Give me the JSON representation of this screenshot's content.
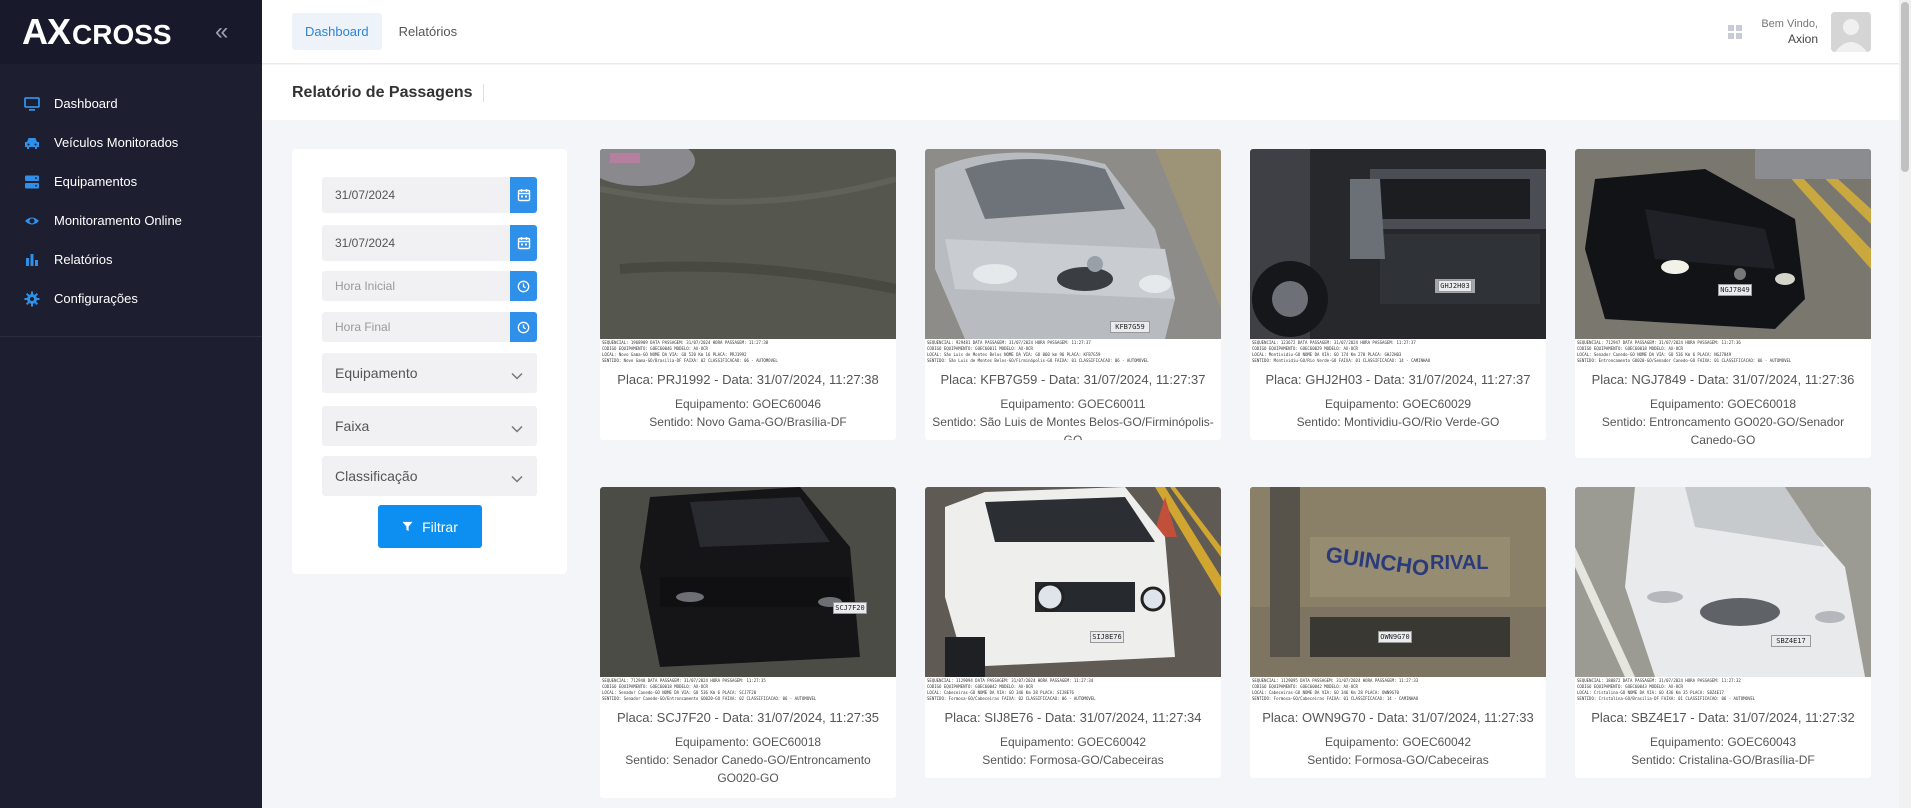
{
  "app": {
    "logo_ax": "AX",
    "logo_cross": "CROSS",
    "collapse_glyph": "«"
  },
  "sidebar": {
    "items": [
      {
        "label": "Dashboard",
        "icon": "monitor-icon"
      },
      {
        "label": "Veículos Monitorados",
        "icon": "car-icon"
      },
      {
        "label": "Equipamentos",
        "icon": "server-icon"
      },
      {
        "label": "Monitoramento Online",
        "icon": "eye-icon"
      },
      {
        "label": "Relatórios",
        "icon": "bar-chart-icon"
      },
      {
        "label": "Configurações",
        "icon": "gear-icon"
      }
    ]
  },
  "topbar": {
    "tabs": [
      {
        "label": "Dashboard",
        "active": true
      },
      {
        "label": "Relatórios",
        "active": false
      }
    ],
    "welcome": "Bem Vindo,",
    "user": "Axion"
  },
  "page": {
    "title": "Relatório de Passagens"
  },
  "filter": {
    "date_start": "31/07/2024",
    "date_end": "31/07/2024",
    "hour_start_placeholder": "Hora Inicial",
    "hour_end_placeholder": "Hora Final",
    "equipment_label": "Equipamento",
    "lane_label": "Faixa",
    "class_label": "Classificação",
    "submit_label": "Filtrar",
    "accent": "#0d8ff2"
  },
  "cards": [
    {
      "plate": "Placa: PRJ1992 - Data: 31/07/2024, 11:27:38",
      "equipment": "Equipamento: GOEC60046",
      "direction": "Sentido: Novo Gama-GO/Brasília-DF",
      "caption": [
        "SEQUENCIAL: 1968909 DATA PASSAGEM: 31/07/2024 HORA PASSAGEM: 11:27:38",
        "CODIGO EQUIPAMENTO: GOEC60046 MODELO: AX-OCR",
        "LOCAL: Novo Gama-GO NOME DA VIA: GO 520 Km 16 PLACA: PRJ1992",
        "SENTIDO: Novo Gama-GO/Brasilia-DF FAIXA: 02 CLASSIFICACAO: 06 - AUTOMOVEL"
      ],
      "plate_text": ""
    },
    {
      "plate": "Placa: KFB7G59 - Data: 31/07/2024, 11:27:37",
      "equipment": "Equipamento: GOEC60011",
      "direction": "Sentido: São Luis de Montes Belos-GO/Firminópolis-GO",
      "caption": [
        "SEQUENCIAL: 929481 DATA PASSAGEM: 31/07/2024 HORA PASSAGEM: 11:27:37",
        "CODIGO EQUIPAMENTO: GOEC60011 MODELO: AX-OCR",
        "LOCAL: São Luis de Montes Belos NOME DA VIA: GO 060 km 96 PLACA: KFB7G59",
        "SENTIDO: São Luis de Montes Belos-GO/Firminópolis-GO FAIXA: 01 CLASSIFICACAO: 06 - AUTOMOVEL"
      ],
      "plate_text": "KFB7G59"
    },
    {
      "plate": "Placa: GHJ2H03 - Data: 31/07/2024, 11:27:37",
      "equipment": "Equipamento: GOEC60029",
      "direction": "Sentido: Montividiu-GO/Rio Verde-GO",
      "caption": [
        "SEQUENCIAL: 123672 DATA PASSAGEM: 31/07/2024 HORA PASSAGEM: 11:27:37",
        "CODIGO EQUIPAMENTO: GOEC60029 MODELO: AX-OCR",
        "LOCAL: Montividiu-GO NOME DA VIA: GO 174 Km 270 PLACA: GHJ2H03",
        "SENTIDO: Montividiu-GO/Rio Verde-GO FAIXA: 01 CLASSIFICACAO: 14 - CAMINHAO"
      ],
      "plate_text": "GHJ2H03"
    },
    {
      "plate": "Placa: NGJ7849 - Data: 31/07/2024, 11:27:36",
      "equipment": "Equipamento: GOEC60018",
      "direction": "Sentido: Entroncamento GO020-GO/Senador Canedo-GO",
      "caption": [
        "SEQUENCIAL: 712947 DATA PASSAGEM: 31/07/2024 HORA PASSAGEM: 11:27:36",
        "CODIGO EQUIPAMENTO: GOEC60018 MODELO: AX-OCR",
        "LOCAL: Senador Canedo-GO NOME DA VIA: GO 536 Km 6 PLACA: NGJ7849",
        "SENTIDO: Entroncamento GO020-GO/Senador Canedo-GO FAIXA: 01 CLASSIFICACAO: 06 - AUTOMOVEL"
      ],
      "plate_text": "NGJ7849"
    },
    {
      "plate": "Placa: SCJ7F20 - Data: 31/07/2024, 11:27:35",
      "equipment": "Equipamento: GOEC60018",
      "direction": "Sentido: Senador Canedo-GO/Entroncamento GO020-GO",
      "caption": [
        "SEQUENCIAL: 712948 DATA PASSAGEM: 31/07/2024 HORA PASSAGEM: 11:27:35",
        "CODIGO EQUIPAMENTO: GOEC60018 MODELO: AX-OCR",
        "LOCAL: Senador Canedo-GO NOME DA VIA: GO 536 Km 6 PLACA: SCJ7F20",
        "SENTIDO: Senador Canedo-GO/Entroncamento GO020-GO FAIXA: 02 CLASSIFICACAO: 06 - AUTOMOVEL"
      ],
      "plate_text": "SCJ7F20"
    },
    {
      "plate": "Placa: SIJ8E76 - Data: 31/07/2024, 11:27:34",
      "equipment": "Equipamento: GOEC60042",
      "direction": "Sentido: Formosa-GO/Cabeceiras",
      "caption": [
        "SEQUENCIAL: 1129094 DATA PASSAGEM: 31/07/2024 HORA PASSAGEM: 11:27:34",
        "CODIGO EQUIPAMENTO: GOEC60042 MODELO: AX-OCR",
        "LOCAL: Cabeceiras-GO NOME DA VIA: GO 346 Km 28 PLACA: SIJ8E76",
        "SENTIDO: Formosa-GO/Cabeceiras FAIXA: 02 CLASSIFICACAO: 06 - AUTOMOVEL"
      ],
      "plate_text": "SIJ8E76"
    },
    {
      "plate": "Placa: OWN9G70 - Data: 31/07/2024, 11:27:33",
      "equipment": "Equipamento: GOEC60042",
      "direction": "Sentido: Formosa-GO/Cabeceiras",
      "caption": [
        "SEQUENCIAL: 1129095 DATA PASSAGEM: 31/07/2024 HORA PASSAGEM: 11:27:33",
        "CODIGO EQUIPAMENTO: GOEC60042 MODELO: AX-OCR",
        "LOCAL: Cabeceiras-GO NOME DA VIA: GO 346 Km 28 PLACA: OWN9G70",
        "SENTIDO: Formosa-GO/Cabeceiras FAIXA: 01 CLASSIFICACAO: 14 - CAMINHAO"
      ],
      "plate_text": "OWN9G70"
    },
    {
      "plate": "Placa: SBZ4E17 - Data: 31/07/2024, 11:27:32",
      "equipment": "Equipamento: GOEC60043",
      "direction": "Sentido: Cristalina-GO/Brasília-DF",
      "caption": [
        "SEQUENCIAL: 180872 DATA PASSAGEM: 31/07/2024 HORA PASSAGEM: 11:27:32",
        "CODIGO EQUIPAMENTO: GOEC60043 MODELO: AX-OCR",
        "LOCAL: Cristalina-GO NOME DA VIA: GO 436 Km 35 PLACA: SBZ4E17",
        "SENTIDO: Cristalina-GO/Brasilia-DF FAIXA: 01 CLASSIFICACAO: 06 - AUTOMOVEL"
      ],
      "plate_text": "SBZ4E17"
    }
  ]
}
